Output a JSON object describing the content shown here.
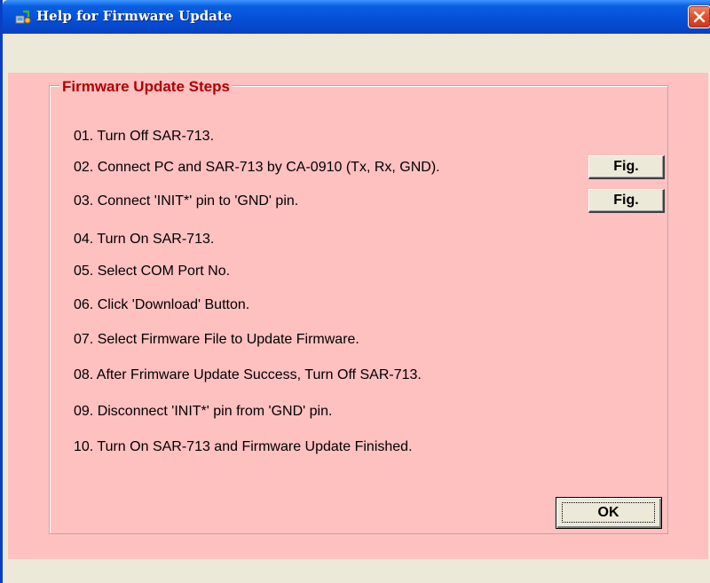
{
  "window": {
    "title": "Help for Firmware Update",
    "title_icon": "update-app-icon",
    "close_icon": "close-icon"
  },
  "group": {
    "title": "Firmware Update Steps"
  },
  "steps": [
    "01.  Turn Off SAR-713.",
    "02.  Connect PC and SAR-713 by CA-0910 (Tx, Rx, GND).",
    "03.  Connect 'INIT*' pin to 'GND' pin.",
    "04.  Turn On SAR-713.",
    "05.  Select COM Port No.",
    "06.  Click 'Download' Button.",
    "07.  Select Firmware File to Update Firmware.",
    "08.  After Frimware Update Success, Turn Off SAR-713.",
    "09.  Disconnect 'INIT*' pin from 'GND' pin.",
    "10.  Turn On SAR-713 and Firmware Update Finished."
  ],
  "buttons": {
    "fig_step02": "Fig.",
    "fig_step03": "Fig.",
    "ok": "OK"
  },
  "colors": {
    "content_background": "#ffc0c0",
    "group_title": "#b00000",
    "titlebar": "#0550d8",
    "close_button": "#e2532e"
  }
}
